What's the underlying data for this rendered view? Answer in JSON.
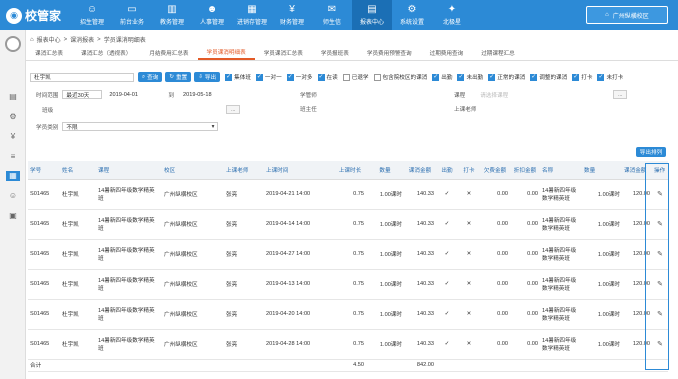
{
  "app": {
    "logo_text": "校管家"
  },
  "nav": [
    {
      "label": "招生管理",
      "icon": "person-icon"
    },
    {
      "label": "前台业务",
      "icon": "desk-icon"
    },
    {
      "label": "教务管理",
      "icon": "book-icon"
    },
    {
      "label": "人事管理",
      "icon": "people-icon"
    },
    {
      "label": "进销存管理",
      "icon": "box-icon"
    },
    {
      "label": "财务管理",
      "icon": "money-icon"
    },
    {
      "label": "师生信",
      "icon": "mail-icon"
    },
    {
      "label": "报表中心",
      "icon": "report-icon"
    },
    {
      "label": "系统设置",
      "icon": "gear-icon"
    },
    {
      "label": "北极星",
      "icon": "star-icon"
    }
  ],
  "campus": {
    "label": "广州纵横校区"
  },
  "breadcrumb": {
    "home": "报表中心",
    "mid": "课消报表",
    "current": "学员课消明细表"
  },
  "tabs": [
    "课消汇总表",
    "课消汇总（透视表）",
    "月结费用汇总表",
    "学员课消明细表",
    "学员课消汇总表",
    "学员报班表",
    "学员费用预警查询",
    "过期费用查询",
    "过期课程汇总"
  ],
  "filters": {
    "student_name": "杜宇凯",
    "search_label": "查询",
    "reset_label": "重置",
    "export_label": "导出",
    "checks1": [
      {
        "label": "集体班",
        "on": true
      },
      {
        "label": "一对一",
        "on": true
      },
      {
        "label": "一对多",
        "on": true
      },
      {
        "label": "在读",
        "on": true
      },
      {
        "label": "已退学",
        "on": false
      },
      {
        "label": "包含院校区的课消",
        "on": false
      },
      {
        "label": "出勤",
        "on": true
      },
      {
        "label": "未出勤",
        "on": true
      },
      {
        "label": "正常的课消",
        "on": true
      },
      {
        "label": "调整的课消",
        "on": true
      },
      {
        "label": "打卡",
        "on": true
      },
      {
        "label": "未打卡",
        "on": true
      }
    ],
    "time_range_label": "时间范围",
    "time_range_value": "最近30天",
    "date_from": "2019-04-01",
    "to_label": "到",
    "date_to": "2019-05-18",
    "manager_label": "学管师",
    "course_label": "课程",
    "course_placeholder": "请选择课程",
    "grade_label": "班级",
    "class_teacher_label": "班主任",
    "teacher_label": "上课老师",
    "student_type_label": "学员类别",
    "student_type_value": "不限",
    "more_btn": "...",
    "export_list_label": "导出排列"
  },
  "table": {
    "headers": [
      "学号",
      "姓名",
      "课程",
      "校区",
      "上课老师",
      "上课时间",
      "上课时长",
      "数量",
      "课消金额",
      "出勤",
      "打卡",
      "欠费金额",
      "折扣金额",
      "名称",
      "数量",
      "课消金额",
      "操作"
    ],
    "group_header": "赠送课程",
    "rows": [
      {
        "id": "S01465",
        "name": "杜宇凯",
        "course": "14暑新四年级数学精英班",
        "campus": "广州纵横校区",
        "teacher": "张亮",
        "time": "2019-04-21 14:00",
        "dur": "0.75",
        "qty": "1.00课时",
        "amt": "140.33",
        "attend": "✓",
        "punch": "✕",
        "owe": "0.00",
        "disc": "0.00",
        "gname": "14暑新四年级数学精英班",
        "gqty": "1.00课时",
        "gamt": "120.00"
      },
      {
        "id": "S01465",
        "name": "杜宇凯",
        "course": "14暑新四年级数学精英班",
        "campus": "广州纵横校区",
        "teacher": "张亮",
        "time": "2019-04-14 14:00",
        "dur": "0.75",
        "qty": "1.00课时",
        "amt": "140.33",
        "attend": "✓",
        "punch": "✕",
        "owe": "0.00",
        "disc": "0.00",
        "gname": "14暑新四年级数学精英班",
        "gqty": "1.00课时",
        "gamt": "120.00"
      },
      {
        "id": "S01465",
        "name": "杜宇凯",
        "course": "14暑新四年级数学精英班",
        "campus": "广州纵横校区",
        "teacher": "张亮",
        "time": "2019-04-27 14:00",
        "dur": "0.75",
        "qty": "1.00课时",
        "amt": "140.33",
        "attend": "✓",
        "punch": "✕",
        "owe": "0.00",
        "disc": "0.00",
        "gname": "14暑新四年级数学精英班",
        "gqty": "1.00课时",
        "gamt": "120.00"
      },
      {
        "id": "S01465",
        "name": "杜宇凯",
        "course": "14暑新四年级数学精英班",
        "campus": "广州纵横校区",
        "teacher": "张亮",
        "time": "2019-04-13 14:00",
        "dur": "0.75",
        "qty": "1.00课时",
        "amt": "140.33",
        "attend": "✓",
        "punch": "✕",
        "owe": "0.00",
        "disc": "0.00",
        "gname": "14暑新四年级数学精英班",
        "gqty": "1.00课时",
        "gamt": "120.00"
      },
      {
        "id": "S01465",
        "name": "杜宇凯",
        "course": "14暑新四年级数学精英班",
        "campus": "广州纵横校区",
        "teacher": "张亮",
        "time": "2019-04-20 14:00",
        "dur": "0.75",
        "qty": "1.00课时",
        "amt": "140.33",
        "attend": "✓",
        "punch": "✕",
        "owe": "0.00",
        "disc": "0.00",
        "gname": "14暑新四年级数学精英班",
        "gqty": "1.00课时",
        "gamt": "120.00"
      },
      {
        "id": "S01465",
        "name": "杜宇凯",
        "course": "14暑新四年级数学精英班",
        "campus": "广州纵横校区",
        "teacher": "张亮",
        "time": "2019-04-28 14:00",
        "dur": "0.75",
        "qty": "1.00课时",
        "amt": "140.33",
        "attend": "✓",
        "punch": "✕",
        "owe": "0.00",
        "disc": "0.00",
        "gname": "14暑新四年级数学精英班",
        "gqty": "1.00课时",
        "gamt": "120.00"
      }
    ],
    "summary": {
      "label": "合计",
      "dur": "4.50",
      "amt": "842.00"
    }
  },
  "colors": {
    "brand": "#2c8ad6",
    "active_tab": "#e35a27"
  }
}
